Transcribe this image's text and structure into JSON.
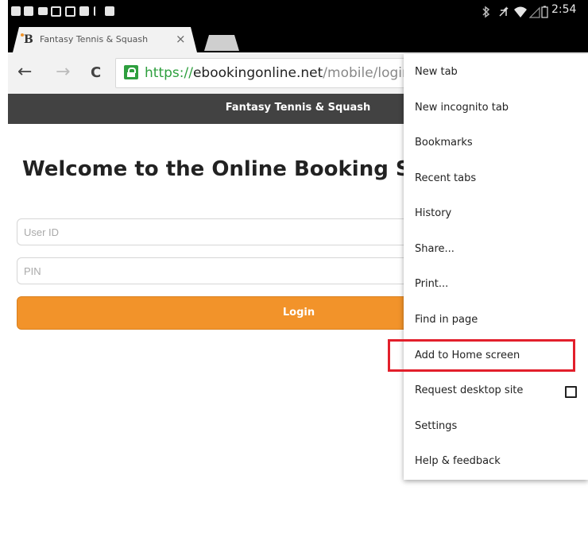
{
  "status_bar": {
    "time": "2:54",
    "colors": {
      "background": "#000000",
      "icon": "#e6e6e6"
    }
  },
  "tab": {
    "favicon": "B",
    "title": "Fantasy Tennis & Squash",
    "close_icon": "×"
  },
  "toolbar": {
    "back_icon": "←",
    "forward_icon": "→",
    "reload_icon": "C",
    "url": {
      "scheme": "https://",
      "host": "ebookingonline.net",
      "path": "/mobile/login.php"
    }
  },
  "page": {
    "header_title": "Fantasy Tennis & Squash",
    "welcome": "Welcome to the Online Booking System",
    "user_id_placeholder": "User ID",
    "pin_placeholder": "PIN",
    "login_label": "Login",
    "colors": {
      "header": "#424242",
      "login_button": "#f2932a",
      "secure": "#2e9f3e"
    }
  },
  "menu": {
    "items": [
      {
        "label": "New tab"
      },
      {
        "label": "New incognito tab"
      },
      {
        "label": "Bookmarks"
      },
      {
        "label": "Recent tabs"
      },
      {
        "label": "History"
      },
      {
        "label": "Share..."
      },
      {
        "label": "Print..."
      },
      {
        "label": "Find in page"
      },
      {
        "label": "Add to Home screen",
        "highlighted": true
      },
      {
        "label": "Request desktop site",
        "checkbox": false
      },
      {
        "label": "Settings"
      },
      {
        "label": "Help & feedback"
      }
    ],
    "highlight_color": "#e21f2b"
  }
}
